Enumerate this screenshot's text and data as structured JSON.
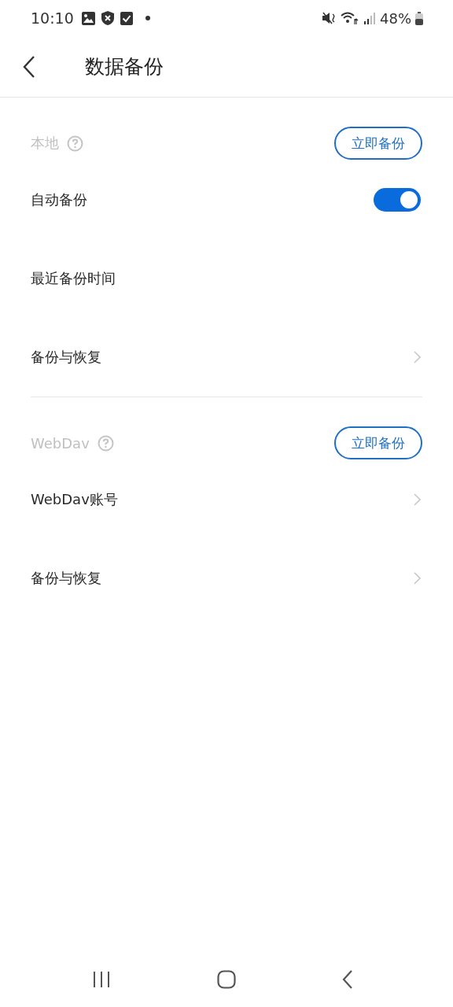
{
  "status_bar": {
    "time": "10:10",
    "battery": "48%"
  },
  "header": {
    "title": "数据备份"
  },
  "sections": [
    {
      "label": "本地",
      "button": "立即备份",
      "rows": [
        {
          "kind": "toggle",
          "label": "自动备份",
          "on": true
        },
        {
          "kind": "plain",
          "label": "最近备份时间"
        },
        {
          "kind": "link",
          "label": "备份与恢复"
        }
      ]
    },
    {
      "label": "WebDav",
      "button": "立即备份",
      "rows": [
        {
          "kind": "link",
          "label": "WebDav账号"
        },
        {
          "kind": "link",
          "label": "备份与恢复"
        }
      ]
    }
  ]
}
